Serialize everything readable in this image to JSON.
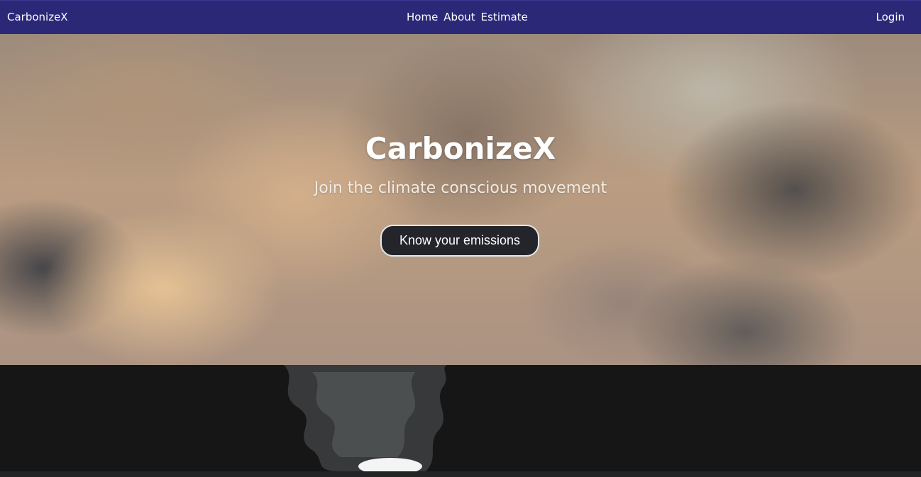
{
  "navbar": {
    "brand": "CarbonizeX",
    "links": [
      "Home",
      "About",
      "Estimate"
    ],
    "login": "Login",
    "background": "#2b2878"
  },
  "hero": {
    "title": "CarbonizeX",
    "subtitle": "Join the climate conscious movement",
    "cta_label": "Know your emissions"
  }
}
